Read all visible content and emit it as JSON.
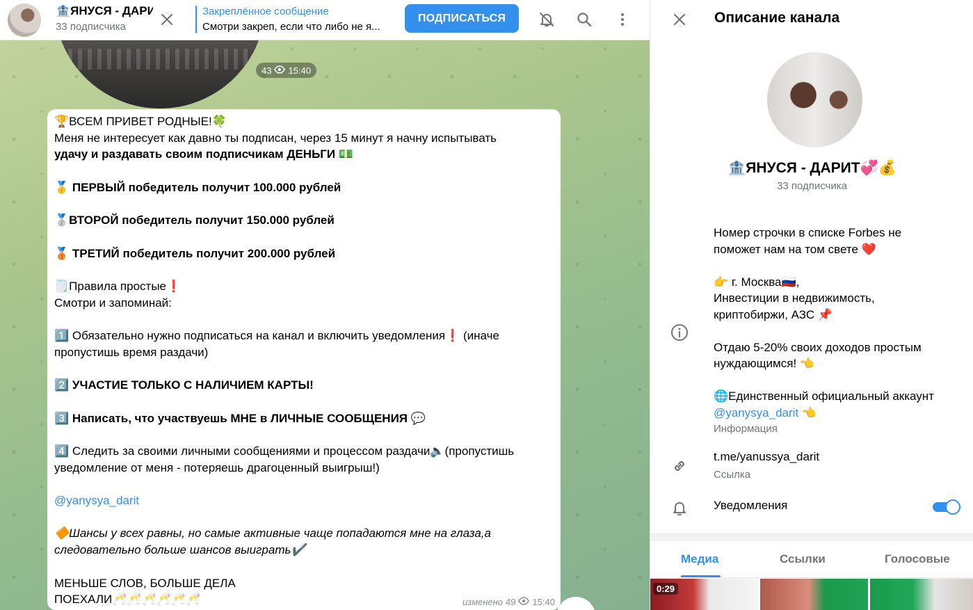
{
  "header": {
    "title": "🏦ЯНУСЯ - ДАРИТ💞💰",
    "subscribers": "33 подписчика",
    "pinned_title": "Закреплённое сообщение",
    "pinned_text": "Смотри закреп, если что либо не я...",
    "subscribe_label": "ПОДПИСАТЬСЯ",
    "icons": [
      "close-icon",
      "mute-icon",
      "search-icon",
      "more-icon"
    ]
  },
  "video_message": {
    "views": "43",
    "time": "15:40"
  },
  "message": {
    "lines": [
      "🏆ВСЕМ ПРИВЕТ РОДНЫЕ!🍀",
      "Меня не интересует как давно ты подписан, через 15 минут я начну испытывать",
      "удачу и раздавать своим подписчикам ДЕНЬГИ 💵",
      "",
      "🥇 ПЕРВЫЙ победитель получит 100.000 рублей",
      "",
      "🥈ВТОРОЙ победитель получит 150.000 рублей",
      "",
      "🥉 ТРЕТИЙ победитель получит 200.000 рублей",
      "",
      "🗒️Правила простые❗",
      "Смотри и запоминай:",
      "",
      "1️⃣ Обязательно нужно подписаться на канал и включить уведомления❗ (иначе",
      "пропустишь время раздачи)",
      "",
      "2️⃣ УЧАСТИЕ ТОЛЬКО С НАЛИЧИЕМ КАРТЫ!",
      "",
      "3️⃣ Написать, что участвуешь МНЕ в ЛИЧНЫЕ СООБЩЕНИЯ 💬",
      "",
      "4️⃣ Следить за своими личными сообщениями и процессом раздачи🔈(пропустишь",
      "уведомление от меня - потеряешь драгоценный выигрыш!)",
      "",
      "@yanysya_darit",
      "",
      "🔶Шансы у всех равны, но самые активные чаще попадаются мне на глаза,а",
      "следовательно больше шансов выиграть✔️",
      "",
      "МЕНЬШЕ СЛОВ, БОЛЬШЕ ДЕЛА",
      "ПОЕХАЛИ🥂🥂🥂🥂🥂🥂"
    ],
    "edited_label": "изменено",
    "views": "49",
    "time": "15:40"
  },
  "panel": {
    "title": "Описание канала",
    "name": "🏦ЯНУСЯ - ДАРИТ💞💰",
    "subscribers": "33 подписчика",
    "description_lines": [
      "Номер строчки в списке Forbes не",
      "поможет нам на том свете ❤️",
      "",
      "👉 г. Москва🇷🇺,",
      "Инвестиции в недвижимость,",
      "криптобиржи, АЗС 📌",
      "",
      "Отдаю 5-20% своих доходов простым",
      "нуждающимся! 👈",
      "",
      "🌐Единственный официальный аккаунт",
      "@yanysya_darit 👈"
    ],
    "description_caption": "Информация",
    "link_value": "t.me/yanussya_darit",
    "link_caption": "Ссылка",
    "notifications_label": "Уведомления",
    "notifications_on": true,
    "tabs": [
      {
        "label": "Медиа",
        "active": true
      },
      {
        "label": "Ссылки",
        "active": false
      },
      {
        "label": "Голосовые",
        "active": false
      }
    ],
    "media_duration": "0:29",
    "accent_color": "#3390ec"
  }
}
